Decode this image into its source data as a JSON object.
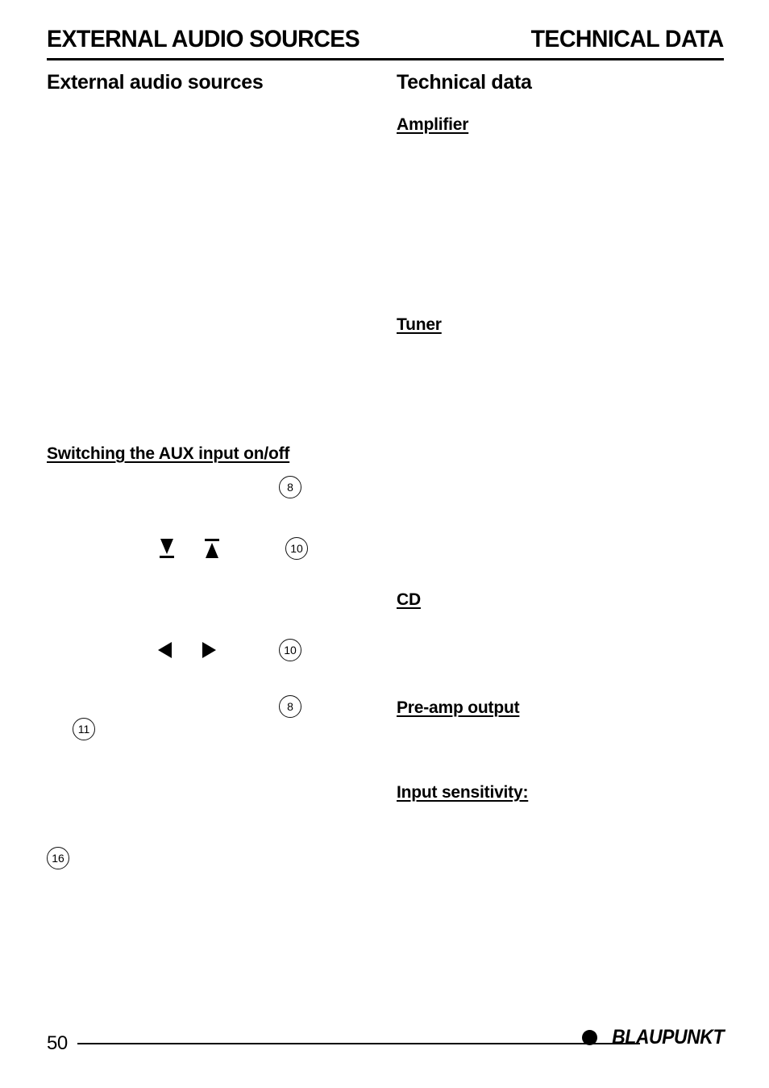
{
  "document": {
    "page_number": "50",
    "brand": "BLAUPUNKT",
    "brand_dot_icon": "filled-circle-icon"
  },
  "running_header": {
    "left": "EXTERNAL AUDIO SOURCES",
    "right": "TECHNICAL DATA"
  },
  "left_column": {
    "section_title": "External audio sources",
    "headings": [
      {
        "text": "Switching the AUX input on/off"
      }
    ],
    "control_badges": [
      {
        "number": "8"
      },
      {
        "number": "10"
      },
      {
        "number": "10"
      },
      {
        "number": "8"
      },
      {
        "number": "11"
      },
      {
        "number": "16"
      }
    ],
    "key_glyphs": [
      {
        "name": "arrow-down-underline-key",
        "symbol": "↓"
      },
      {
        "name": "arrow-up-overline-key",
        "symbol": "↑"
      },
      {
        "name": "arrow-left-key",
        "symbol": "◀"
      },
      {
        "name": "arrow-right-key",
        "symbol": "▶"
      }
    ]
  },
  "right_column": {
    "section_title": "Technical data",
    "headings": [
      {
        "text": "Amplifier"
      },
      {
        "text": "Tuner"
      },
      {
        "text": "CD"
      },
      {
        "text": "Pre-amp output"
      },
      {
        "text": "Input sensitivity:"
      }
    ]
  }
}
